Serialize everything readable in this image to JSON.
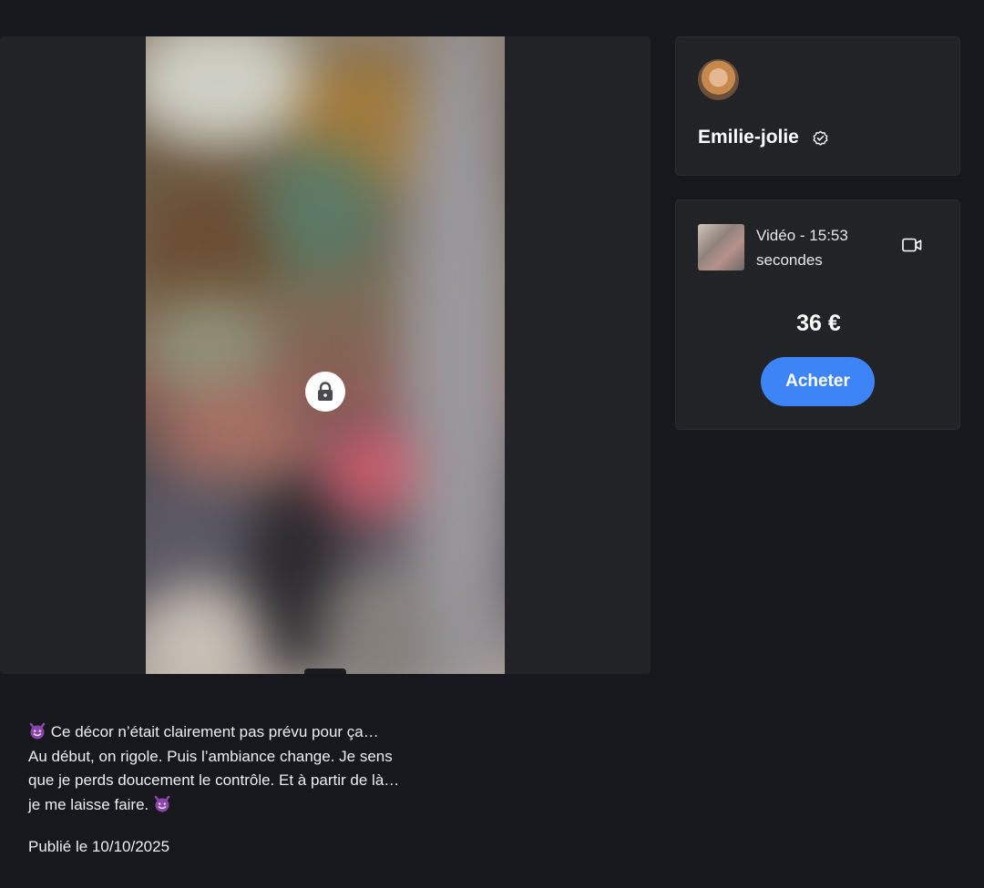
{
  "media": {
    "count": "1",
    "count_icon": "video-icon",
    "lock_icon": "lock-icon"
  },
  "creator": {
    "name": "Emilie-jolie",
    "verified_icon": "verified-check-icon"
  },
  "purchase": {
    "item_title": "Vidéo - 15:53 secondes",
    "item_icon": "video-camera-icon",
    "price": "36 €",
    "buy_label": "Acheter"
  },
  "post": {
    "description_lines": [
      "Ce décor n’était clairement pas prévu pour ça…",
      "Au début, on rigole. Puis l’ambiance change. Je sens que je perds doucement le contrôle. Et à partir de là… je me laisse faire."
    ],
    "published": "Publié le 10/10/2025"
  },
  "colors": {
    "background": "#17181d",
    "card": "#222326",
    "accent": "#3d85f7",
    "emoji_purple": "#8e44ad"
  }
}
